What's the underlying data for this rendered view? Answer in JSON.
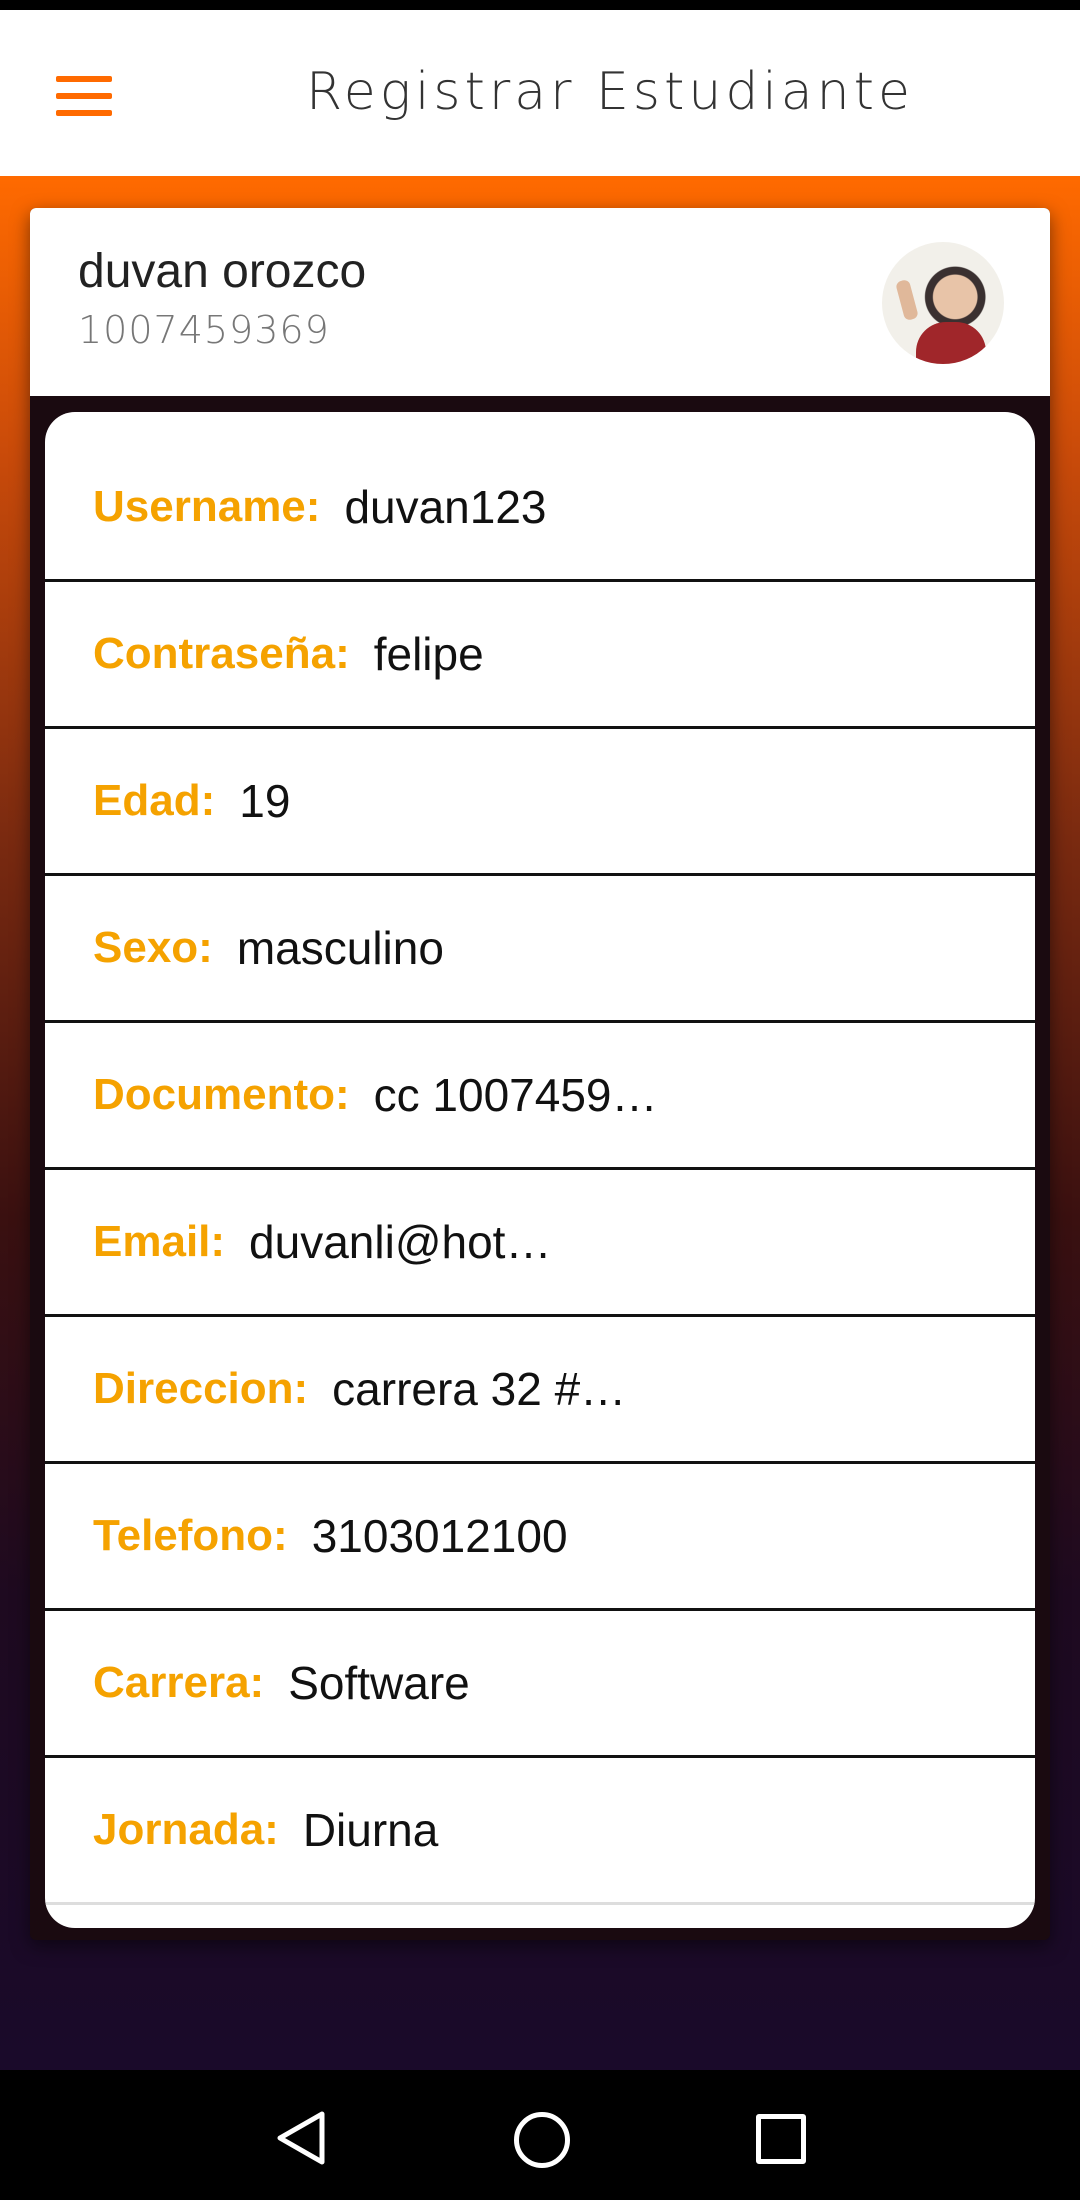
{
  "app_bar": {
    "title": "Registrar Estudiante",
    "menu_icon": "hamburger-menu-icon",
    "accent_color": "#ff6a00"
  },
  "profile": {
    "name": "duvan orozco",
    "id_number": "1007459369"
  },
  "details": [
    {
      "label": "Username:",
      "value": "duvan123"
    },
    {
      "label": "Contraseña:",
      "value": "felipe"
    },
    {
      "label": "Edad:",
      "value": "19"
    },
    {
      "label": "Sexo:",
      "value": "masculino"
    },
    {
      "label": "Documento:",
      "value": "cc 1007459…"
    },
    {
      "label": "Email:",
      "value": "duvanli@hot…"
    },
    {
      "label": "Direccion:",
      "value": "carrera 32 #…"
    },
    {
      "label": "Telefono:",
      "value": "3103012100"
    },
    {
      "label": "Carrera:",
      "value": "Software"
    },
    {
      "label": "Jornada:",
      "value": "Diurna"
    }
  ],
  "colors": {
    "label_color": "#f5a200",
    "gradient_top": "#ff6a00",
    "gradient_bottom": "#1a0a2a"
  },
  "nav_bar": {
    "back_icon": "back-triangle-icon",
    "home_icon": "home-circle-icon",
    "recent_icon": "recent-apps-square-icon"
  }
}
